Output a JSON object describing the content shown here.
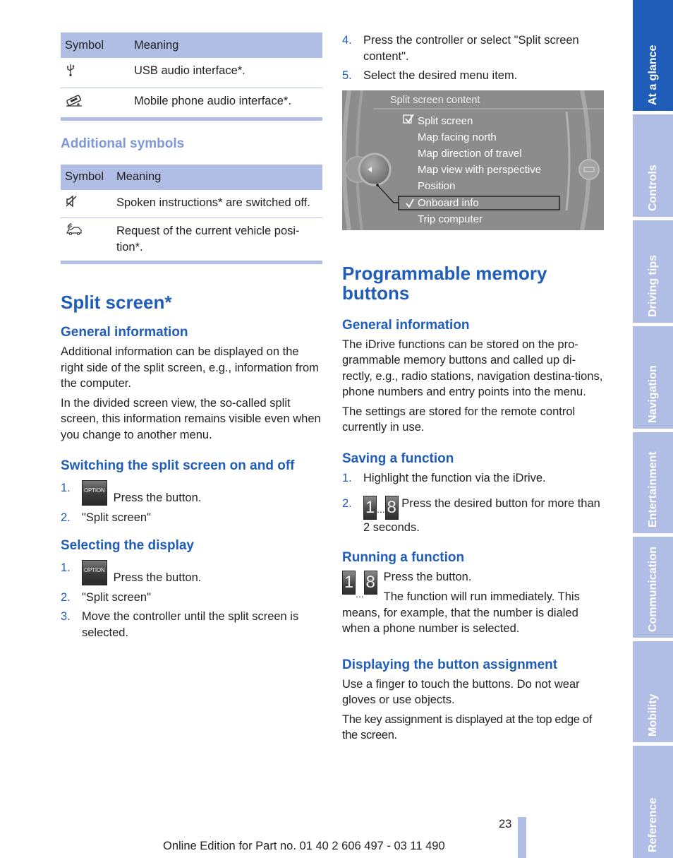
{
  "table1": {
    "headers": [
      "Symbol",
      "Meaning"
    ],
    "rows": [
      {
        "icon": "usb-icon",
        "meaning": "USB audio interface*."
      },
      {
        "icon": "mobile-phone-icon",
        "meaning": "Mobile phone audio interface*."
      }
    ]
  },
  "additional_symbols": {
    "title": "Additional symbols",
    "headers": [
      "Symbol",
      "Meaning"
    ],
    "rows": [
      {
        "icon": "speaker-muted-icon",
        "meaning": "Spoken instructions* are switched off."
      },
      {
        "icon": "vehicle-position-icon",
        "meaning": "Request of the current vehicle posi-tion*."
      }
    ]
  },
  "split_screen": {
    "title": "Split screen*",
    "general": {
      "heading": "General information",
      "paragraphs": [
        "Additional information can be displayed on the right side of the split screen, e.g., information from the computer.",
        "In the divided screen view, the so-called split screen, this information remains visible even when you change to another menu."
      ]
    },
    "switching": {
      "heading": "Switching the split screen on and off",
      "steps": [
        {
          "num": "1.",
          "button": "OPTION",
          "text": "Press the button."
        },
        {
          "num": "2.",
          "text": "\"Split screen\""
        }
      ]
    },
    "selecting": {
      "heading": "Selecting the display",
      "steps": [
        {
          "num": "1.",
          "button": "OPTION",
          "text": "Press the button."
        },
        {
          "num": "2.",
          "text": "\"Split screen\""
        },
        {
          "num": "3.",
          "text": "Move the controller until the split screen is selected."
        },
        {
          "num": "4.",
          "text": "Press the controller or select \"Split screen content\"."
        },
        {
          "num": "5.",
          "text": "Select the desired menu item."
        }
      ]
    }
  },
  "idrive_screen": {
    "title": "Split screen content",
    "items": [
      {
        "label": "Split screen",
        "mark": "checkbox-checked"
      },
      {
        "label": "Map facing north",
        "mark": ""
      },
      {
        "label": "Map direction of travel",
        "mark": ""
      },
      {
        "label": "Map view with perspective",
        "mark": ""
      },
      {
        "label": "Position",
        "mark": ""
      },
      {
        "label": "Onboard info",
        "mark": "check",
        "selected": true
      },
      {
        "label": "Trip computer",
        "mark": ""
      }
    ]
  },
  "memory_buttons": {
    "title": "Programmable memory buttons",
    "general": {
      "heading": "General information",
      "paragraphs": [
        "The iDrive functions can be stored on the pro-grammable memory buttons and called up di-rectly, e.g., radio stations, navigation destina-tions, phone numbers and entry points into the menu.",
        "The settings are stored for the remote control currently in use."
      ]
    },
    "saving": {
      "heading": "Saving a function",
      "steps": [
        {
          "num": "1.",
          "text": "Highlight the function via the iDrive."
        },
        {
          "num": "2.",
          "button_first": "1",
          "button_last": "8",
          "ellipsis": "...",
          "text": "Press the desired button for more than 2 seconds."
        }
      ]
    },
    "running": {
      "heading": "Running a function",
      "button_first": "1",
      "button_last": "8",
      "ellipsis": "...",
      "line1": "Press the button.",
      "line2": "The function will run immediately. This means, for example, that the number is dialed when a phone number is selected."
    },
    "displaying": {
      "heading": "Displaying the button assignment",
      "paragraphs": [
        "Use a finger to touch the buttons. Do not wear gloves or use objects.",
        "The key assignment is displayed at the top edge of the screen."
      ]
    }
  },
  "side_tabs": [
    {
      "label": "At a glance",
      "active": true
    },
    {
      "label": "Controls",
      "active": false
    },
    {
      "label": "Driving tips",
      "active": false
    },
    {
      "label": "Navigation",
      "active": false
    },
    {
      "label": "Entertainment",
      "active": false
    },
    {
      "label": "Communication",
      "active": false
    },
    {
      "label": "Mobility",
      "active": false
    },
    {
      "label": "Reference",
      "active": false
    }
  ],
  "footer": {
    "page_number": "23",
    "edition": "Online Edition for Part no. 01 40 2 606 497 - 03 11 490"
  },
  "colors": {
    "accent_blue": "#1f5db8",
    "light_blue": "#b0bde4",
    "muted_heading": "#7f97d4"
  }
}
